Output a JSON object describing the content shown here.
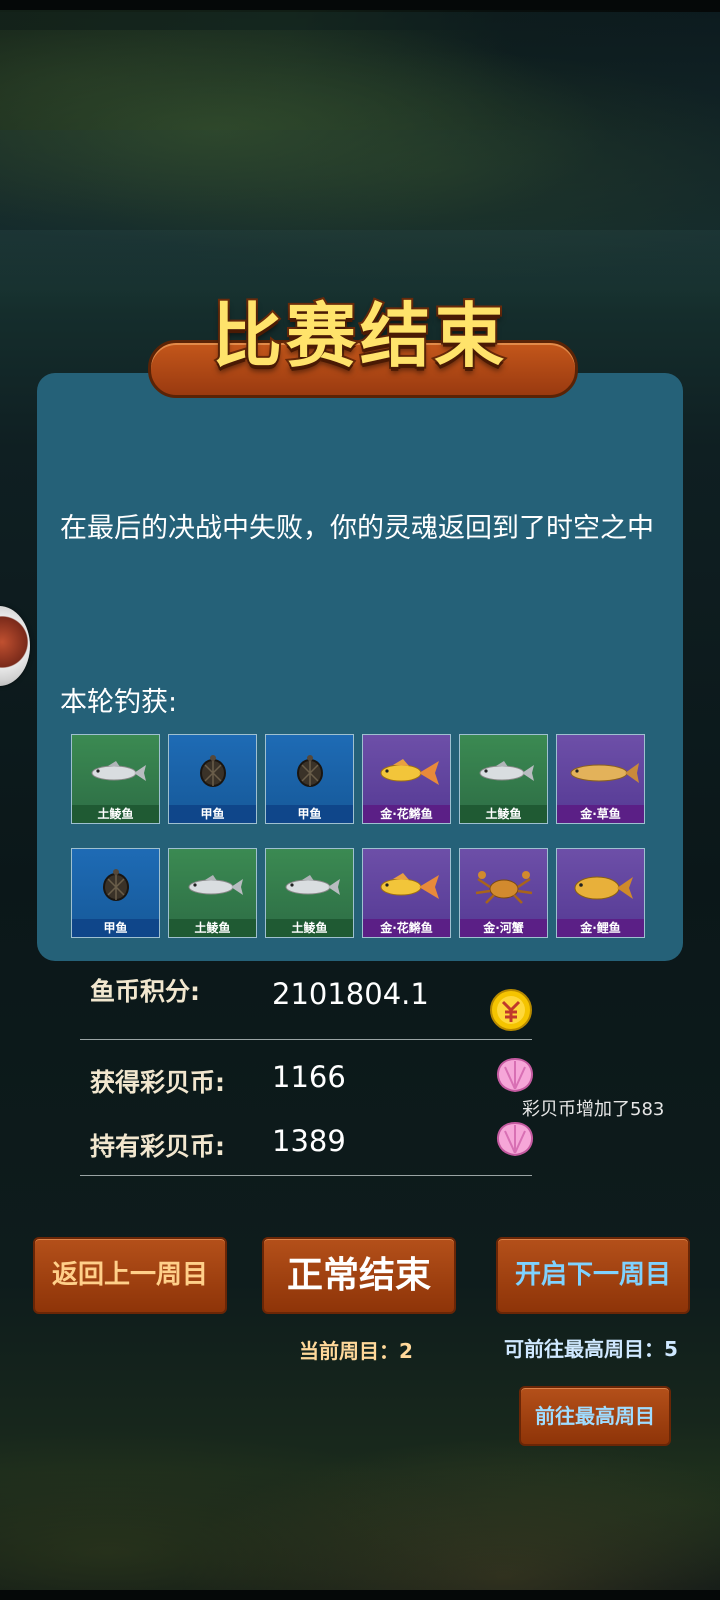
{
  "title": "比赛结束",
  "message": "在最后的决战中失败，你的灵魂返回到了时空之中",
  "catch_label": "本轮钓获:",
  "catches": [
    {
      "name": "土鲮鱼",
      "rarity": "green",
      "icon": "silver-fish-icon"
    },
    {
      "name": "甲鱼",
      "rarity": "blue",
      "icon": "turtle-icon"
    },
    {
      "name": "甲鱼",
      "rarity": "blue",
      "icon": "turtle-icon"
    },
    {
      "name": "金·花鳉鱼",
      "rarity": "purple",
      "icon": "golden-guppy-icon"
    },
    {
      "name": "土鲮鱼",
      "rarity": "green",
      "icon": "silver-fish-icon"
    },
    {
      "name": "金·草鱼",
      "rarity": "purple",
      "icon": "golden-grass-carp-icon"
    },
    {
      "name": "甲鱼",
      "rarity": "blue",
      "icon": "turtle-icon"
    },
    {
      "name": "土鲮鱼",
      "rarity": "green",
      "icon": "silver-fish-icon"
    },
    {
      "name": "土鲮鱼",
      "rarity": "green",
      "icon": "silver-fish-icon"
    },
    {
      "name": "金·花鳉鱼",
      "rarity": "purple",
      "icon": "golden-guppy-icon"
    },
    {
      "name": "金·河蟹",
      "rarity": "purple",
      "icon": "golden-crab-icon"
    },
    {
      "name": "金·鲤鱼",
      "rarity": "purple",
      "icon": "golden-carp-icon"
    }
  ],
  "stats": {
    "fish_coin_label": "鱼币积分:",
    "fish_coin_value": "2101804.1",
    "shell_gained_label": "获得彩贝币:",
    "shell_gained_value": "1166",
    "shell_held_label": "持有彩贝币:",
    "shell_held_value": "1389",
    "shell_note": "彩贝币增加了583"
  },
  "buttons": {
    "prev": "返回上一周目",
    "end": "正常结束",
    "next": "开启下一周目",
    "max": "前往最高周目"
  },
  "round": {
    "current": "当前周目：2",
    "max": "可前往最高周目：5"
  },
  "colors": {
    "panel": "#256178",
    "title": "#ffe36b",
    "button": "#a9480f",
    "green_card": "#3b8a52",
    "blue_card": "#1e6bb5",
    "purple_card": "#6d4fa8"
  }
}
